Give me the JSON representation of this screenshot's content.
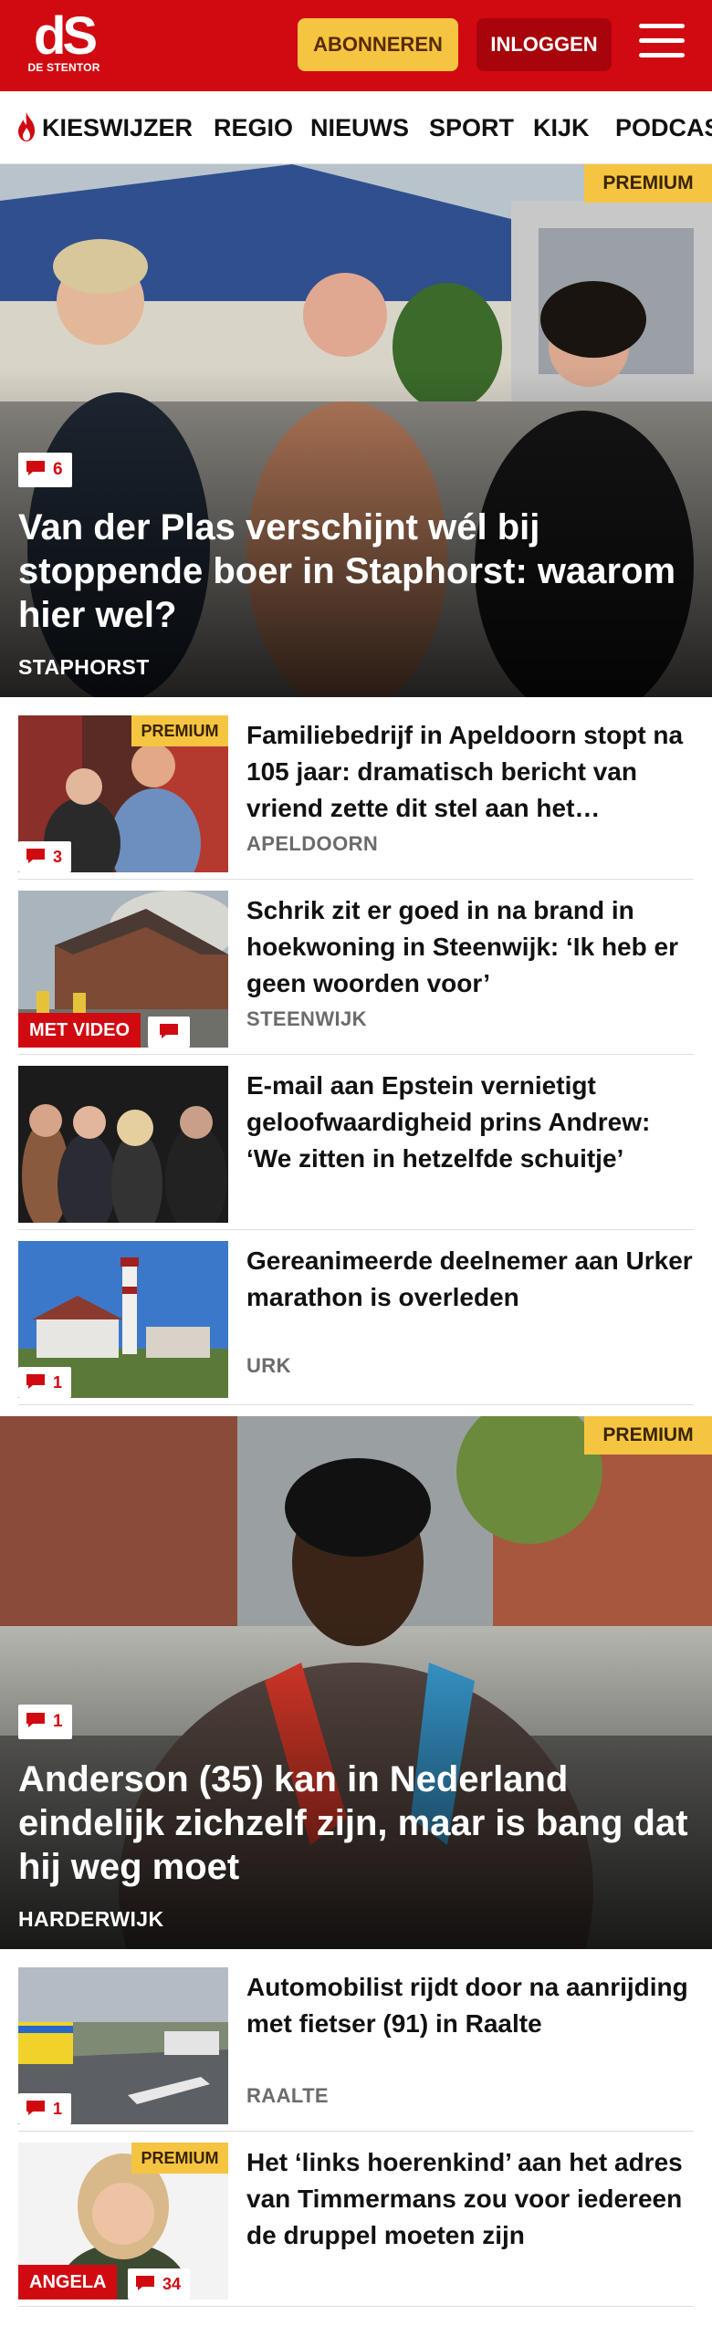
{
  "header": {
    "logo_mark": "dS",
    "logo_sub": "DE STENTOR",
    "subscribe_label": "ABONNEREN",
    "login_label": "INLOGGEN"
  },
  "nav": {
    "items": [
      "KIESWIJZER",
      "REGIO",
      "NIEUWS",
      "SPORT",
      "KIJK",
      "PODCAST"
    ]
  },
  "articles": [
    {
      "type": "hero",
      "premium": "PREMIUM",
      "comments": "6",
      "title": "Van der Plas verschijnt wél bij stoppende boer in Staphorst: waarom hier wel?",
      "place": "STAPHORST"
    },
    {
      "type": "card",
      "premium": "PREMIUM",
      "comments": "3",
      "title": "Familiebedrijf in Apeldoorn stopt na 105 jaar: dramatisch bericht van vriend zette dit stel aan het…",
      "place": "APELDOORN"
    },
    {
      "type": "card",
      "label": "MET VIDEO",
      "title": "Schrik zit er goed in na brand in hoekwoning in Steenwijk: ‘Ik heb er geen woorden voor’",
      "place": "STEENWIJK"
    },
    {
      "type": "card",
      "title": "E-mail aan Epstein vernietigt geloofwaardigheid prins Andrew: ‘We zitten in hetzelfde schuitje’"
    },
    {
      "type": "card",
      "comments": "1",
      "title": "Gereanimeerde deelnemer aan Urker marathon is overleden",
      "place": "URK"
    },
    {
      "type": "hero",
      "premium": "PREMIUM",
      "comments": "1",
      "title": "Anderson (35) kan in Nederland eindelijk zichzelf zijn, maar is bang dat hij weg moet",
      "place": "HARDERWIJK"
    },
    {
      "type": "card",
      "comments": "1",
      "title": "Automobilist rijdt door na aanrijding met fietser (91) in Raalte",
      "place": "RAALTE"
    },
    {
      "type": "card",
      "premium": "PREMIUM",
      "label": "ANGELA",
      "comments": "34",
      "title": "Het ‘links hoerenkind’ aan het adres van Timmermans zou voor iedereen de druppel moeten zijn"
    }
  ],
  "colors": {
    "brand_red": "#d10a11",
    "premium_yellow": "#f5c542",
    "login_dark_red": "#a8040b"
  }
}
